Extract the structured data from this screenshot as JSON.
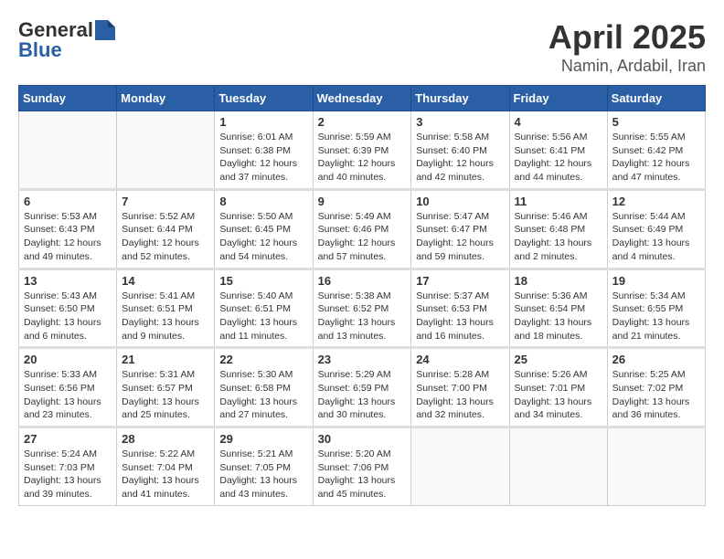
{
  "header": {
    "logo_general": "General",
    "logo_blue": "Blue",
    "title": "April 2025",
    "location": "Namin, Ardabil, Iran"
  },
  "weekdays": [
    "Sunday",
    "Monday",
    "Tuesday",
    "Wednesday",
    "Thursday",
    "Friday",
    "Saturday"
  ],
  "weeks": [
    [
      {
        "day": "",
        "sunrise": "",
        "sunset": "",
        "daylight": ""
      },
      {
        "day": "",
        "sunrise": "",
        "sunset": "",
        "daylight": ""
      },
      {
        "day": "1",
        "sunrise": "Sunrise: 6:01 AM",
        "sunset": "Sunset: 6:38 PM",
        "daylight": "Daylight: 12 hours and 37 minutes."
      },
      {
        "day": "2",
        "sunrise": "Sunrise: 5:59 AM",
        "sunset": "Sunset: 6:39 PM",
        "daylight": "Daylight: 12 hours and 40 minutes."
      },
      {
        "day": "3",
        "sunrise": "Sunrise: 5:58 AM",
        "sunset": "Sunset: 6:40 PM",
        "daylight": "Daylight: 12 hours and 42 minutes."
      },
      {
        "day": "4",
        "sunrise": "Sunrise: 5:56 AM",
        "sunset": "Sunset: 6:41 PM",
        "daylight": "Daylight: 12 hours and 44 minutes."
      },
      {
        "day": "5",
        "sunrise": "Sunrise: 5:55 AM",
        "sunset": "Sunset: 6:42 PM",
        "daylight": "Daylight: 12 hours and 47 minutes."
      }
    ],
    [
      {
        "day": "6",
        "sunrise": "Sunrise: 5:53 AM",
        "sunset": "Sunset: 6:43 PM",
        "daylight": "Daylight: 12 hours and 49 minutes."
      },
      {
        "day": "7",
        "sunrise": "Sunrise: 5:52 AM",
        "sunset": "Sunset: 6:44 PM",
        "daylight": "Daylight: 12 hours and 52 minutes."
      },
      {
        "day": "8",
        "sunrise": "Sunrise: 5:50 AM",
        "sunset": "Sunset: 6:45 PM",
        "daylight": "Daylight: 12 hours and 54 minutes."
      },
      {
        "day": "9",
        "sunrise": "Sunrise: 5:49 AM",
        "sunset": "Sunset: 6:46 PM",
        "daylight": "Daylight: 12 hours and 57 minutes."
      },
      {
        "day": "10",
        "sunrise": "Sunrise: 5:47 AM",
        "sunset": "Sunset: 6:47 PM",
        "daylight": "Daylight: 12 hours and 59 minutes."
      },
      {
        "day": "11",
        "sunrise": "Sunrise: 5:46 AM",
        "sunset": "Sunset: 6:48 PM",
        "daylight": "Daylight: 13 hours and 2 minutes."
      },
      {
        "day": "12",
        "sunrise": "Sunrise: 5:44 AM",
        "sunset": "Sunset: 6:49 PM",
        "daylight": "Daylight: 13 hours and 4 minutes."
      }
    ],
    [
      {
        "day": "13",
        "sunrise": "Sunrise: 5:43 AM",
        "sunset": "Sunset: 6:50 PM",
        "daylight": "Daylight: 13 hours and 6 minutes."
      },
      {
        "day": "14",
        "sunrise": "Sunrise: 5:41 AM",
        "sunset": "Sunset: 6:51 PM",
        "daylight": "Daylight: 13 hours and 9 minutes."
      },
      {
        "day": "15",
        "sunrise": "Sunrise: 5:40 AM",
        "sunset": "Sunset: 6:51 PM",
        "daylight": "Daylight: 13 hours and 11 minutes."
      },
      {
        "day": "16",
        "sunrise": "Sunrise: 5:38 AM",
        "sunset": "Sunset: 6:52 PM",
        "daylight": "Daylight: 13 hours and 13 minutes."
      },
      {
        "day": "17",
        "sunrise": "Sunrise: 5:37 AM",
        "sunset": "Sunset: 6:53 PM",
        "daylight": "Daylight: 13 hours and 16 minutes."
      },
      {
        "day": "18",
        "sunrise": "Sunrise: 5:36 AM",
        "sunset": "Sunset: 6:54 PM",
        "daylight": "Daylight: 13 hours and 18 minutes."
      },
      {
        "day": "19",
        "sunrise": "Sunrise: 5:34 AM",
        "sunset": "Sunset: 6:55 PM",
        "daylight": "Daylight: 13 hours and 21 minutes."
      }
    ],
    [
      {
        "day": "20",
        "sunrise": "Sunrise: 5:33 AM",
        "sunset": "Sunset: 6:56 PM",
        "daylight": "Daylight: 13 hours and 23 minutes."
      },
      {
        "day": "21",
        "sunrise": "Sunrise: 5:31 AM",
        "sunset": "Sunset: 6:57 PM",
        "daylight": "Daylight: 13 hours and 25 minutes."
      },
      {
        "day": "22",
        "sunrise": "Sunrise: 5:30 AM",
        "sunset": "Sunset: 6:58 PM",
        "daylight": "Daylight: 13 hours and 27 minutes."
      },
      {
        "day": "23",
        "sunrise": "Sunrise: 5:29 AM",
        "sunset": "Sunset: 6:59 PM",
        "daylight": "Daylight: 13 hours and 30 minutes."
      },
      {
        "day": "24",
        "sunrise": "Sunrise: 5:28 AM",
        "sunset": "Sunset: 7:00 PM",
        "daylight": "Daylight: 13 hours and 32 minutes."
      },
      {
        "day": "25",
        "sunrise": "Sunrise: 5:26 AM",
        "sunset": "Sunset: 7:01 PM",
        "daylight": "Daylight: 13 hours and 34 minutes."
      },
      {
        "day": "26",
        "sunrise": "Sunrise: 5:25 AM",
        "sunset": "Sunset: 7:02 PM",
        "daylight": "Daylight: 13 hours and 36 minutes."
      }
    ],
    [
      {
        "day": "27",
        "sunrise": "Sunrise: 5:24 AM",
        "sunset": "Sunset: 7:03 PM",
        "daylight": "Daylight: 13 hours and 39 minutes."
      },
      {
        "day": "28",
        "sunrise": "Sunrise: 5:22 AM",
        "sunset": "Sunset: 7:04 PM",
        "daylight": "Daylight: 13 hours and 41 minutes."
      },
      {
        "day": "29",
        "sunrise": "Sunrise: 5:21 AM",
        "sunset": "Sunset: 7:05 PM",
        "daylight": "Daylight: 13 hours and 43 minutes."
      },
      {
        "day": "30",
        "sunrise": "Sunrise: 5:20 AM",
        "sunset": "Sunset: 7:06 PM",
        "daylight": "Daylight: 13 hours and 45 minutes."
      },
      {
        "day": "",
        "sunrise": "",
        "sunset": "",
        "daylight": ""
      },
      {
        "day": "",
        "sunrise": "",
        "sunset": "",
        "daylight": ""
      },
      {
        "day": "",
        "sunrise": "",
        "sunset": "",
        "daylight": ""
      }
    ]
  ]
}
